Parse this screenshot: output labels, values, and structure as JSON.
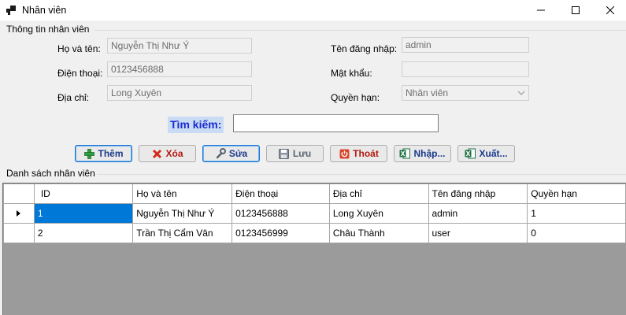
{
  "window": {
    "title": "Nhân viên"
  },
  "info_group": {
    "title": "Thông tin nhân viên"
  },
  "form": {
    "name_label": "Họ và tên:",
    "name_value": "Nguyễn Thị Như Ý",
    "phone_label": "Điện thoại:",
    "phone_value": "0123456888",
    "address_label": "Địa chỉ:",
    "address_value": "Long Xuyên",
    "username_label": "Tên đăng nhập:",
    "username_value": "admin",
    "password_label": "Mật khẩu:",
    "password_value": "",
    "role_label": "Quyền hạn:",
    "role_value": "Nhân viên"
  },
  "search": {
    "label": "Tìm kiếm:",
    "value": ""
  },
  "toolbar": {
    "add_label": "Thêm",
    "delete_label": "Xóa",
    "edit_label": "Sửa",
    "save_label": "Lưu",
    "exit_label": "Thoát",
    "import_label": "Nhập...",
    "export_label": "Xuất..."
  },
  "list_group": {
    "title": "Danh sách nhân viên"
  },
  "table": {
    "columns": [
      "ID",
      "Họ và tên",
      "Điện thoại",
      "Địa chỉ",
      "Tên đăng nhập",
      "Quyền hạn"
    ],
    "rows": [
      [
        "1",
        "Nguyễn Thị Như Ý",
        "0123456888",
        "Long Xuyên",
        "admin",
        "1"
      ],
      [
        "2",
        "Trần Thị Cẩm Vân",
        "0123456999",
        "Châu Thành",
        "user",
        "0"
      ]
    ]
  },
  "colors": {
    "accent": "#0078d7",
    "search_label_bg": "#c9dcf4",
    "search_label_text": "#1c2bd3",
    "grid_background": "#9b9b9b"
  },
  "icons": {
    "app": "app-window-icon",
    "add": "green-plus-icon",
    "delete": "red-x-icon",
    "edit": "wrench-icon",
    "save": "floppy-disk-icon",
    "exit": "power-icon",
    "import": "excel-icon",
    "export": "excel-icon"
  }
}
